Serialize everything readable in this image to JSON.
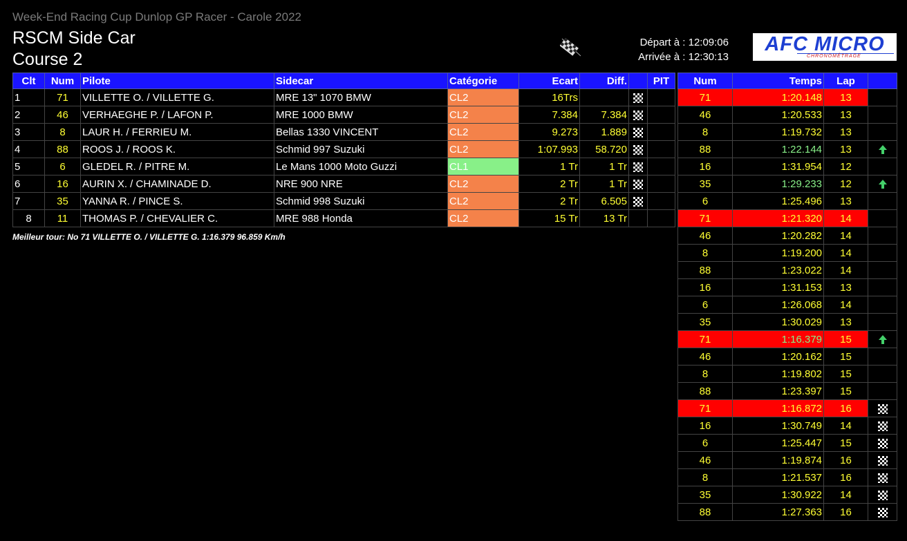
{
  "header": {
    "event": "Week-End Racing Cup Dunlop GP Racer - Carole 2022",
    "race_class": "RSCM Side Car",
    "race_name": "Course 2",
    "depart": "Départ à : 12:09:06",
    "arrivee": "Arrivée à : 12:30:13",
    "logo_text": "AFC MICRO",
    "logo_subtext": "CHRONOMÉTRAGE",
    "flag_icon": "checkered-flag-icon"
  },
  "results": {
    "columns": [
      "Clt",
      "Num",
      "Pilote",
      "Sidecar",
      "Catégorie",
      "Ecart",
      "Diff.",
      "",
      "PIT"
    ],
    "rows": [
      {
        "clt": "1",
        "num": "71",
        "pilote": "VILLETTE O. / VILLETTE G.",
        "sidecar": "MRE 13\" 1070 BMW",
        "cat": "CL2",
        "ecart": "16Trs",
        "diff": "",
        "flag": true
      },
      {
        "clt": "2",
        "num": "46",
        "pilote": "VERHAEGHE P. / LAFON P.",
        "sidecar": "MRE 1000 BMW",
        "cat": "CL2",
        "ecart": "7.384",
        "diff": "7.384",
        "flag": true
      },
      {
        "clt": "3",
        "num": "8",
        "pilote": "LAUR H. / FERRIEU M.",
        "sidecar": "Bellas 1330 VINCENT",
        "cat": "CL2",
        "ecart": "9.273",
        "diff": "1.889",
        "flag": true
      },
      {
        "clt": "4",
        "num": "88",
        "pilote": "ROOS J. / ROOS K.",
        "sidecar": "Schmid 997 Suzuki",
        "cat": "CL2",
        "ecart": "1:07.993",
        "diff": "58.720",
        "flag": true
      },
      {
        "clt": "5",
        "num": "6",
        "pilote": "GLEDEL R. / PITRE M.",
        "sidecar": "Le Mans 1000 Moto Guzzi",
        "cat": "CL1",
        "ecart": "1 Tr",
        "diff": "1 Tr",
        "flag": true
      },
      {
        "clt": "6",
        "num": "16",
        "pilote": "AURIN X. / CHAMINADE D.",
        "sidecar": "NRE 900 NRE",
        "cat": "CL2",
        "ecart": "2 Tr",
        "diff": "1 Tr",
        "flag": true
      },
      {
        "clt": "7",
        "num": "35",
        "pilote": "YANNA R. / PINCE S.",
        "sidecar": "Schmid 998 Suzuki",
        "cat": "CL2",
        "ecart": "2 Tr",
        "diff": "6.505",
        "flag": true
      },
      {
        "clt": "8",
        "num": "11",
        "pilote": "THOMAS P. / CHEVALIER C.",
        "sidecar": "MRE 988 Honda",
        "cat": "CL2",
        "ecart": "15 Tr",
        "diff": "13 Tr",
        "flag": false
      }
    ],
    "category_colors": {
      "CL2": "#f4824a",
      "CL1": "#88f088"
    },
    "best_lap": "Meilleur tour: No 71 VILLETTE O. / VILLETTE G. 1:16.379 96.859 Km/h"
  },
  "laps": {
    "columns": [
      "Num",
      "Temps",
      "Lap",
      ""
    ],
    "rows": [
      {
        "num": "71",
        "temps": "1:20.148",
        "lap": "13",
        "hl": "red",
        "tc": "yellow",
        "mark": ""
      },
      {
        "num": "46",
        "temps": "1:20.533",
        "lap": "13",
        "hl": "",
        "tc": "yellow",
        "mark": ""
      },
      {
        "num": "8",
        "temps": "1:19.732",
        "lap": "13",
        "hl": "",
        "tc": "yellow",
        "mark": ""
      },
      {
        "num": "88",
        "temps": "1:22.144",
        "lap": "13",
        "hl": "",
        "tc": "green",
        "mark": "arrow-up-icon"
      },
      {
        "num": "16",
        "temps": "1:31.954",
        "lap": "12",
        "hl": "",
        "tc": "yellow",
        "mark": ""
      },
      {
        "num": "35",
        "temps": "1:29.233",
        "lap": "12",
        "hl": "",
        "tc": "green",
        "mark": "arrow-up-icon"
      },
      {
        "num": "6",
        "temps": "1:25.496",
        "lap": "13",
        "hl": "",
        "tc": "yellow",
        "mark": ""
      },
      {
        "num": "71",
        "temps": "1:21.320",
        "lap": "14",
        "hl": "red",
        "tc": "yellow",
        "mark": ""
      },
      {
        "num": "46",
        "temps": "1:20.282",
        "lap": "14",
        "hl": "",
        "tc": "yellow",
        "mark": ""
      },
      {
        "num": "8",
        "temps": "1:19.200",
        "lap": "14",
        "hl": "",
        "tc": "yellow",
        "mark": ""
      },
      {
        "num": "88",
        "temps": "1:23.022",
        "lap": "14",
        "hl": "",
        "tc": "yellow",
        "mark": ""
      },
      {
        "num": "16",
        "temps": "1:31.153",
        "lap": "13",
        "hl": "",
        "tc": "yellow",
        "mark": ""
      },
      {
        "num": "6",
        "temps": "1:26.068",
        "lap": "14",
        "hl": "",
        "tc": "yellow",
        "mark": ""
      },
      {
        "num": "35",
        "temps": "1:30.029",
        "lap": "13",
        "hl": "",
        "tc": "yellow",
        "mark": ""
      },
      {
        "num": "71",
        "temps": "1:16.379",
        "lap": "15",
        "hl": "red",
        "tc": "green",
        "mark": "arrow-up-icon"
      },
      {
        "num": "46",
        "temps": "1:20.162",
        "lap": "15",
        "hl": "",
        "tc": "yellow",
        "mark": ""
      },
      {
        "num": "8",
        "temps": "1:19.802",
        "lap": "15",
        "hl": "",
        "tc": "yellow",
        "mark": ""
      },
      {
        "num": "88",
        "temps": "1:23.397",
        "lap": "15",
        "hl": "",
        "tc": "yellow",
        "mark": ""
      },
      {
        "num": "71",
        "temps": "1:16.872",
        "lap": "16",
        "hl": "red",
        "tc": "yellow",
        "mark": "checkered-flag-icon"
      },
      {
        "num": "16",
        "temps": "1:30.749",
        "lap": "14",
        "hl": "",
        "tc": "yellow",
        "mark": "checkered-flag-icon"
      },
      {
        "num": "6",
        "temps": "1:25.447",
        "lap": "15",
        "hl": "",
        "tc": "yellow",
        "mark": "checkered-flag-icon"
      },
      {
        "num": "46",
        "temps": "1:19.874",
        "lap": "16",
        "hl": "",
        "tc": "yellow",
        "mark": "checkered-flag-icon"
      },
      {
        "num": "8",
        "temps": "1:21.537",
        "lap": "16",
        "hl": "",
        "tc": "yellow",
        "mark": "checkered-flag-icon"
      },
      {
        "num": "35",
        "temps": "1:30.922",
        "lap": "14",
        "hl": "",
        "tc": "yellow",
        "mark": "checkered-flag-icon"
      },
      {
        "num": "88",
        "temps": "1:27.363",
        "lap": "16",
        "hl": "",
        "tc": "yellow",
        "mark": "checkered-flag-icon"
      }
    ]
  }
}
